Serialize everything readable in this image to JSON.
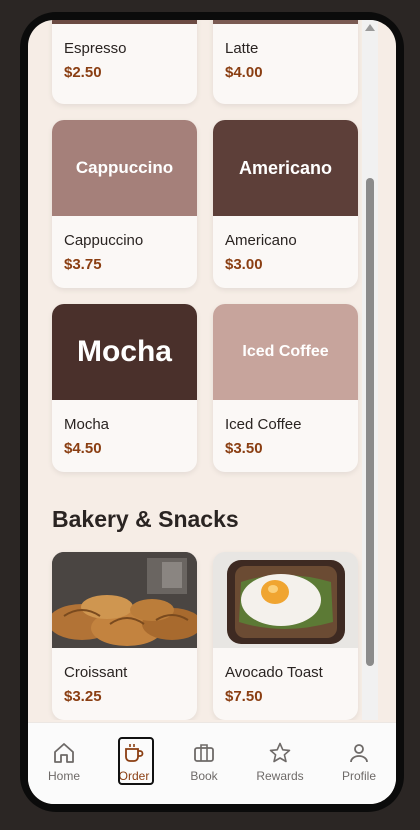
{
  "drinks": [
    {
      "name": "Espresso",
      "price": "$2.50",
      "thumb_label": ""
    },
    {
      "name": "Latte",
      "price": "$4.00",
      "thumb_label": ""
    },
    {
      "name": "Cappuccino",
      "price": "$3.75",
      "thumb_label": "Cappuccino",
      "thumb_color": "#a5807a"
    },
    {
      "name": "Americano",
      "price": "$3.00",
      "thumb_label": "Americano",
      "thumb_color": "#5d3f39"
    },
    {
      "name": "Mocha",
      "price": "$4.50",
      "thumb_label": "Mocha",
      "thumb_color": "#4a302b"
    },
    {
      "name": "Iced Coffee",
      "price": "$3.50",
      "thumb_label": "Iced Coffee",
      "thumb_color": "#c7a49c"
    }
  ],
  "bakery": {
    "title": "Bakery & Snacks",
    "items": [
      {
        "name": "Croissant",
        "price": "$3.25"
      },
      {
        "name": "Avocado Toast",
        "price": "$7.50"
      }
    ]
  },
  "tabs": [
    {
      "label": "Home",
      "icon": "home-icon"
    },
    {
      "label": "Order",
      "icon": "coffee-cup-icon",
      "active": true
    },
    {
      "label": "Book",
      "icon": "briefcase-icon"
    },
    {
      "label": "Rewards",
      "icon": "star-icon"
    },
    {
      "label": "Profile",
      "icon": "person-icon"
    }
  ],
  "colors": {
    "accent": "#8a3e12",
    "background": "#f6ede6"
  }
}
